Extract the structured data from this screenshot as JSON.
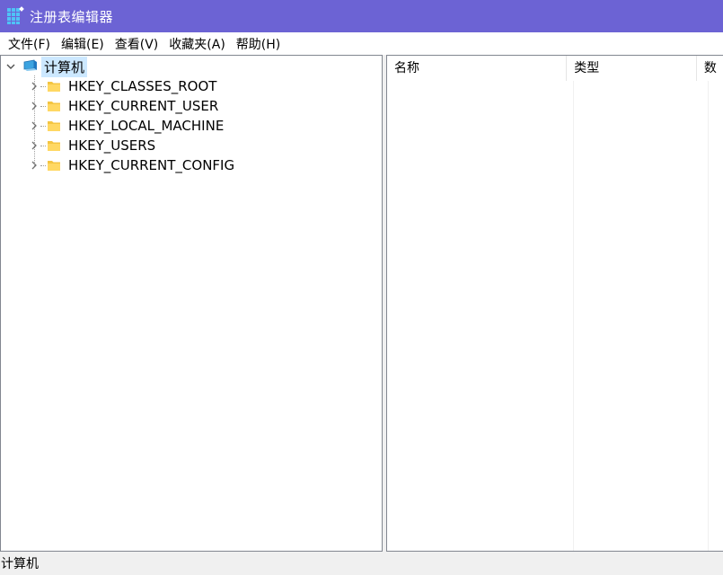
{
  "window": {
    "title": "注册表编辑器"
  },
  "menu": [
    {
      "label": "文件(F)"
    },
    {
      "label": "编辑(E)"
    },
    {
      "label": "查看(V)"
    },
    {
      "label": "收藏夹(A)"
    },
    {
      "label": "帮助(H)"
    }
  ],
  "tree": {
    "root": {
      "label": "计算机",
      "icon": "computer-icon",
      "expanded": true
    },
    "hives": [
      {
        "label": "HKEY_CLASSES_ROOT",
        "icon": "folder-icon"
      },
      {
        "label": "HKEY_CURRENT_USER",
        "icon": "folder-icon"
      },
      {
        "label": "HKEY_LOCAL_MACHINE",
        "icon": "folder-icon"
      },
      {
        "label": "HKEY_USERS",
        "icon": "folder-icon"
      },
      {
        "label": "HKEY_CURRENT_CONFIG",
        "icon": "folder-icon"
      }
    ]
  },
  "list": {
    "columns": [
      {
        "label": "名称"
      },
      {
        "label": "类型"
      },
      {
        "label": "数"
      }
    ]
  },
  "status": {
    "path": "计算机"
  },
  "colors": {
    "titlebar": "#6c63d4",
    "selection": "#cce8ff",
    "folder": "#f4c542"
  }
}
